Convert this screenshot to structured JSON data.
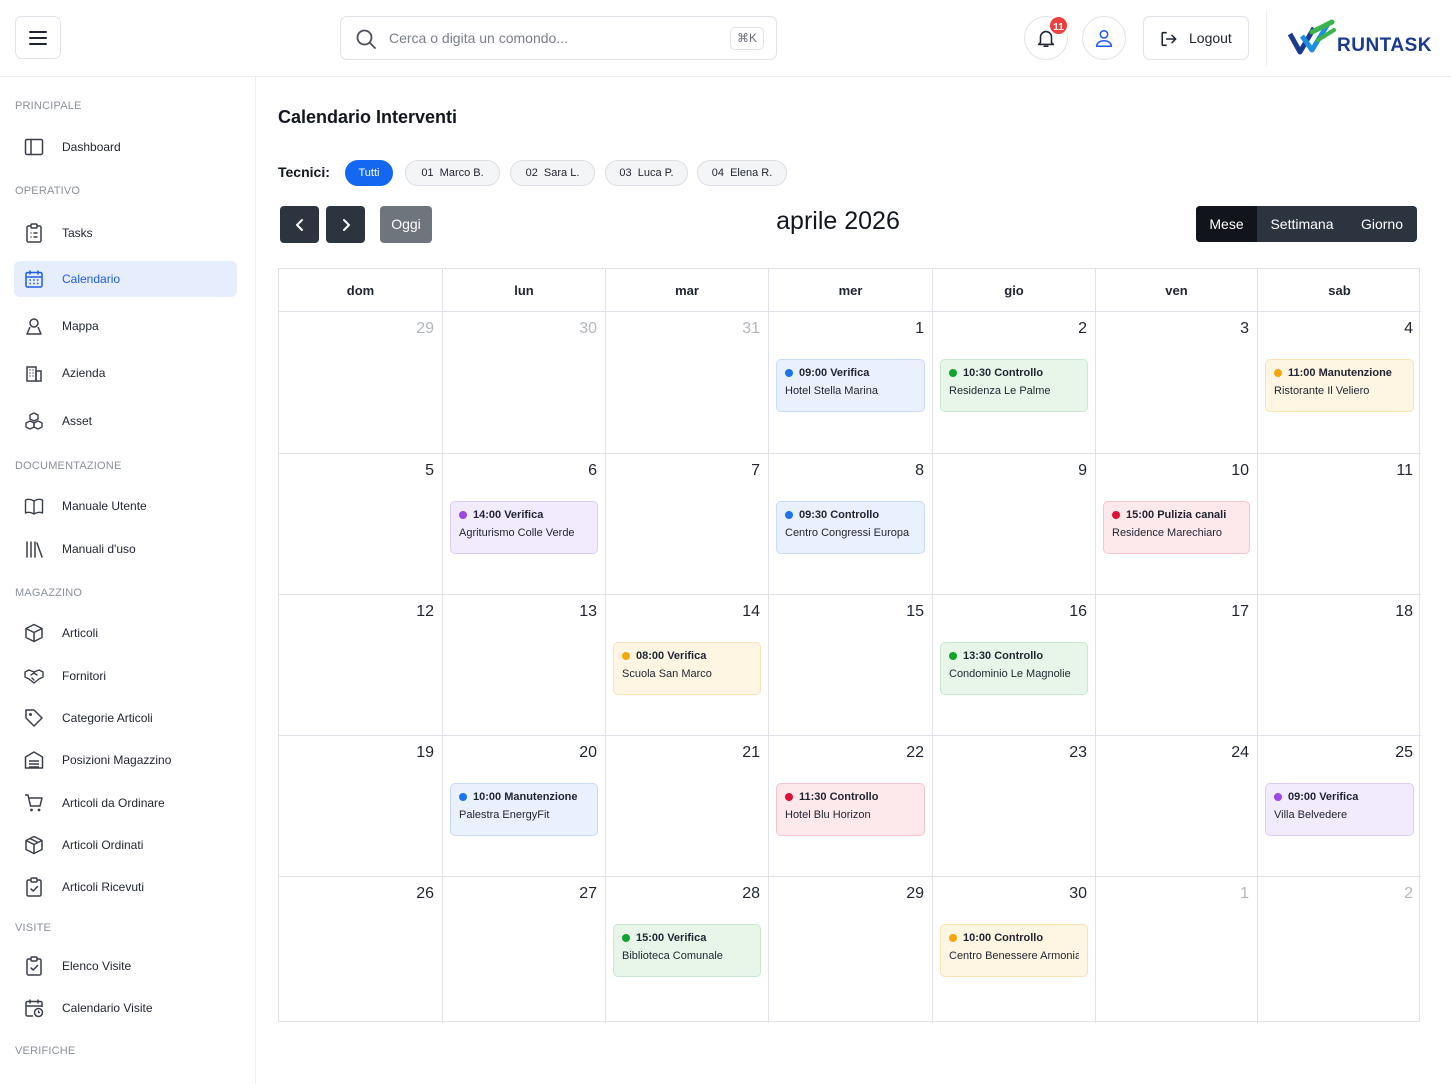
{
  "header": {
    "search_placeholder": "Cerca o digita un comondo...",
    "search_shortcut": "⌘K",
    "notification_count": "11",
    "logout_label": "Logout",
    "logo_text": "RUNTASK"
  },
  "sidebar": {
    "sections": [
      {
        "title": "PRINCIPALE",
        "items": [
          {
            "label": "Dashboard",
            "icon": "dashboard-icon"
          }
        ]
      },
      {
        "title": "OPERATIVO",
        "items": [
          {
            "label": "Tasks",
            "icon": "tasks-icon"
          },
          {
            "label": "Calendario",
            "icon": "calendar-icon",
            "active": true
          },
          {
            "label": "Mappa",
            "icon": "map-icon"
          },
          {
            "label": "Azienda",
            "icon": "building-icon"
          },
          {
            "label": "Asset",
            "icon": "asset-icon"
          }
        ]
      },
      {
        "title": "DOCUMENTAZIONE",
        "items": [
          {
            "label": "Manuale Utente",
            "icon": "book-icon"
          },
          {
            "label": "Manuali d'uso",
            "icon": "library-icon"
          }
        ]
      },
      {
        "title": "MAGAZZINO",
        "items": [
          {
            "label": "Articoli",
            "icon": "box-icon"
          },
          {
            "label": "Fornitori",
            "icon": "handshake-icon"
          },
          {
            "label": "Categorie Articoli",
            "icon": "tag-icon"
          },
          {
            "label": "Posizioni Magazzino",
            "icon": "warehouse-icon"
          },
          {
            "label": "Articoli da Ordinare",
            "icon": "cart-icon"
          },
          {
            "label": "Articoli Ordinati",
            "icon": "package-icon"
          },
          {
            "label": "Articoli Ricevuti",
            "icon": "clipboard-check-icon"
          }
        ]
      },
      {
        "title": "VISITE",
        "items": [
          {
            "label": "Elenco Visite",
            "icon": "clipboard-check-icon"
          },
          {
            "label": "Calendario Visite",
            "icon": "calendar-clock-icon"
          }
        ]
      },
      {
        "title": "VERIFICHE",
        "items": []
      }
    ]
  },
  "main": {
    "title": "Calendario Interventi",
    "technicians_label": "Tecnici:",
    "technicians": [
      {
        "label": "Tutti",
        "active": true
      },
      {
        "label": "01  Marco B."
      },
      {
        "label": "02  Sara L."
      },
      {
        "label": "03  Luca P."
      },
      {
        "label": "04  Elena R."
      }
    ],
    "today_label": "Oggi",
    "month_title": "aprile 2026",
    "views": [
      {
        "label": "Mese",
        "active": true
      },
      {
        "label": "Settimana"
      },
      {
        "label": "Giorno"
      }
    ]
  },
  "calendar": {
    "weekdays": [
      "dom",
      "lun",
      "mar",
      "mer",
      "gio",
      "ven",
      "sab"
    ],
    "colors": {
      "blue": "#1e72f0",
      "green": "#12a330",
      "orange": "#f5a60b",
      "purple": "#9a48e8",
      "red": "#e0103a"
    },
    "weeks": [
      [
        {
          "day": "29",
          "other": true
        },
        {
          "day": "30",
          "other": true
        },
        {
          "day": "31",
          "other": true
        },
        {
          "day": "1",
          "event": {
            "time": "09:00 Verifica",
            "place": "Hotel Stella Marina",
            "color": "blue"
          }
        },
        {
          "day": "2",
          "event": {
            "time": "10:30 Controllo",
            "place": "Residenza Le Palme",
            "color": "green"
          }
        },
        {
          "day": "3"
        },
        {
          "day": "4",
          "event": {
            "time": "11:00 Manutenzione",
            "place": "Ristorante Il Veliero",
            "color": "orange"
          }
        }
      ],
      [
        {
          "day": "5"
        },
        {
          "day": "6",
          "event": {
            "time": "14:00 Verifica",
            "place": "Agriturismo Colle Verde",
            "color": "purple"
          }
        },
        {
          "day": "7"
        },
        {
          "day": "8",
          "event": {
            "time": "09:30 Controllo",
            "place": "Centro Congressi Europa",
            "color": "blue"
          }
        },
        {
          "day": "9"
        },
        {
          "day": "10",
          "event": {
            "time": "15:00 Pulizia canali",
            "place": "Residence Marechiaro",
            "color": "red"
          }
        },
        {
          "day": "11"
        }
      ],
      [
        {
          "day": "12"
        },
        {
          "day": "13"
        },
        {
          "day": "14",
          "event": {
            "time": "08:00 Verifica",
            "place": "Scuola San Marco",
            "color": "orange"
          }
        },
        {
          "day": "15"
        },
        {
          "day": "16",
          "event": {
            "time": "13:30 Controllo",
            "place": "Condominio Le Magnolie",
            "color": "green"
          }
        },
        {
          "day": "17"
        },
        {
          "day": "18"
        }
      ],
      [
        {
          "day": "19"
        },
        {
          "day": "20",
          "event": {
            "time": "10:00 Manutenzione",
            "place": "Palestra EnergyFit",
            "color": "blue"
          }
        },
        {
          "day": "21"
        },
        {
          "day": "22",
          "event": {
            "time": "11:30 Controllo",
            "place": "Hotel Blu Horizon",
            "color": "red"
          }
        },
        {
          "day": "23"
        },
        {
          "day": "24"
        },
        {
          "day": "25",
          "event": {
            "time": "09:00 Verifica",
            "place": "Villa Belvedere",
            "color": "purple"
          }
        }
      ],
      [
        {
          "day": "26"
        },
        {
          "day": "27"
        },
        {
          "day": "28",
          "event": {
            "time": "15:00 Verifica",
            "place": "Biblioteca Comunale",
            "color": "green"
          }
        },
        {
          "day": "29"
        },
        {
          "day": "30",
          "event": {
            "time": "10:00 Controllo",
            "place": "Centro Benessere Armonia",
            "color": "orange"
          }
        },
        {
          "day": "1",
          "other": true
        },
        {
          "day": "2",
          "other": true
        }
      ]
    ]
  }
}
